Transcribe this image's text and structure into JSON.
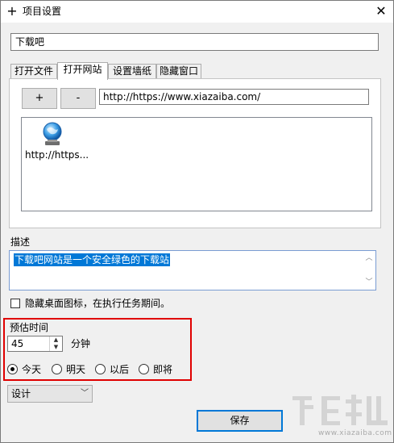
{
  "window": {
    "title": "项目设置",
    "close_glyph": "✕",
    "icon": "plus-icon"
  },
  "project_name": "下载吧",
  "tabs": [
    {
      "label": "打开文件",
      "active": false
    },
    {
      "label": "打开网站",
      "active": true
    },
    {
      "label": "设置墙纸",
      "active": false
    },
    {
      "label": "隐藏窗口",
      "active": false
    }
  ],
  "website_tab": {
    "add_label": "+",
    "remove_label": "-",
    "url_value": "http://https://www.xiazaiba.com/",
    "items": [
      {
        "label": "http://https...",
        "icon": "globe-icon"
      }
    ]
  },
  "description": {
    "label": "描述",
    "value": "下载吧网站是一个安全绿色的下载站"
  },
  "hide_icons": {
    "label": "隐藏桌面图标，在执行任务期间。",
    "checked": false
  },
  "estimate": {
    "label": "预估时间",
    "value": "45",
    "unit": "分钟",
    "options": [
      {
        "label": "今天",
        "checked": true
      },
      {
        "label": "明天",
        "checked": false
      },
      {
        "label": "以后",
        "checked": false
      },
      {
        "label": "即将",
        "checked": false
      }
    ]
  },
  "mode_select": {
    "value": "设计"
  },
  "save_label": "保存",
  "watermark": {
    "text": "www.xiazaiba.com"
  },
  "colors": {
    "highlight": "#e00000",
    "accent": "#0078d7"
  }
}
